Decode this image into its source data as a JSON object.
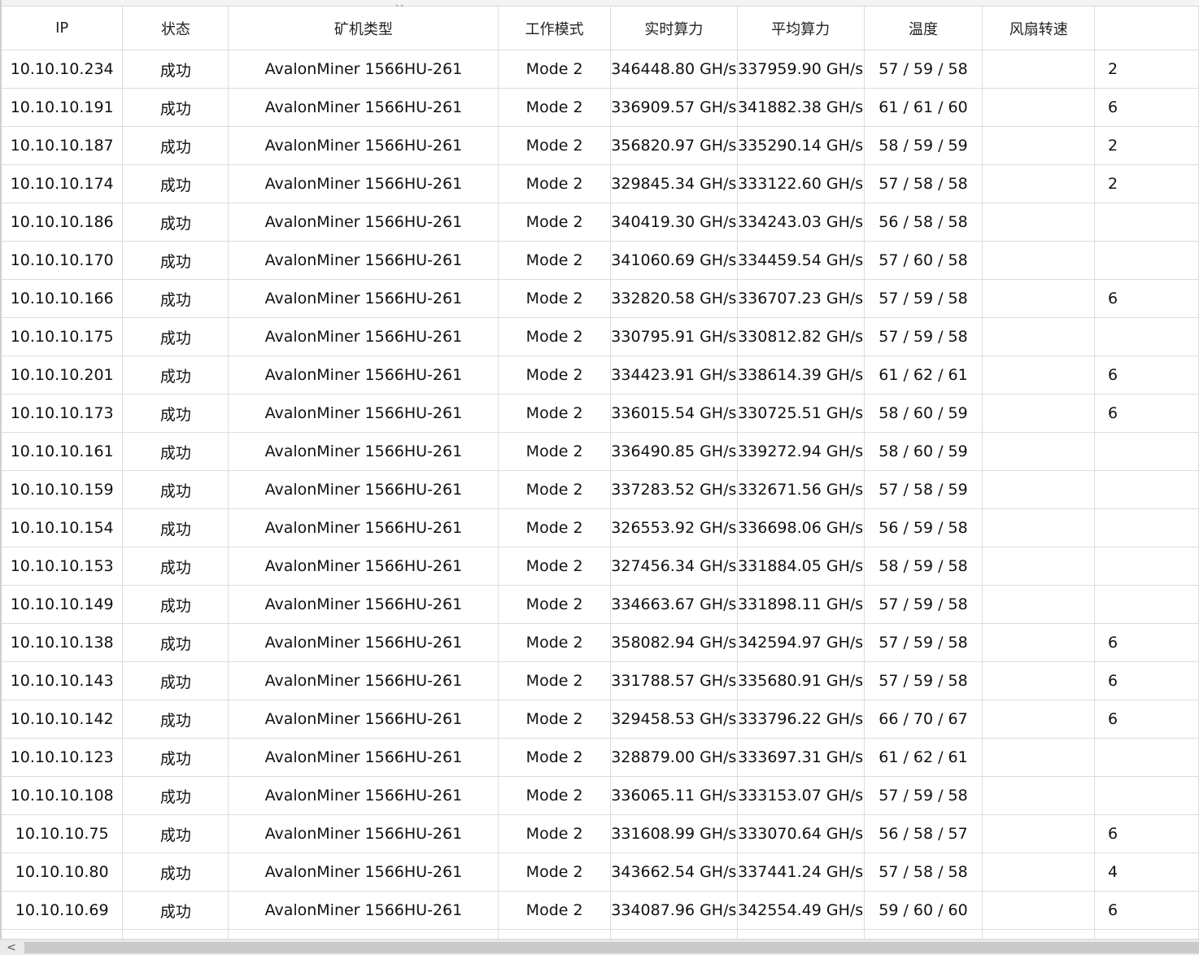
{
  "table": {
    "columns": [
      "IP",
      "状态",
      "矿机类型",
      "工作模式",
      "实时算力",
      "平均算力",
      "温度",
      "风扇转速",
      ""
    ],
    "rows": [
      [
        "10.10.10.234",
        "成功",
        "AvalonMiner 1566HU-261",
        "Mode 2",
        "346448.80 GH/s",
        "337959.90 GH/s",
        "57 / 59 / 58",
        "",
        "2"
      ],
      [
        "10.10.10.191",
        "成功",
        "AvalonMiner 1566HU-261",
        "Mode 2",
        "336909.57 GH/s",
        "341882.38 GH/s",
        "61 / 61 / 60",
        "",
        "6"
      ],
      [
        "10.10.10.187",
        "成功",
        "AvalonMiner 1566HU-261",
        "Mode 2",
        "356820.97 GH/s",
        "335290.14 GH/s",
        "58 / 59 / 59",
        "",
        "2"
      ],
      [
        "10.10.10.174",
        "成功",
        "AvalonMiner 1566HU-261",
        "Mode 2",
        "329845.34 GH/s",
        "333122.60 GH/s",
        "57 / 58 / 58",
        "",
        "2"
      ],
      [
        "10.10.10.186",
        "成功",
        "AvalonMiner 1566HU-261",
        "Mode 2",
        "340419.30 GH/s",
        "334243.03 GH/s",
        "56 / 58 / 58",
        "",
        ""
      ],
      [
        "10.10.10.170",
        "成功",
        "AvalonMiner 1566HU-261",
        "Mode 2",
        "341060.69 GH/s",
        "334459.54 GH/s",
        "57 / 60 / 58",
        "",
        ""
      ],
      [
        "10.10.10.166",
        "成功",
        "AvalonMiner 1566HU-261",
        "Mode 2",
        "332820.58 GH/s",
        "336707.23 GH/s",
        "57 / 59 / 58",
        "",
        "6"
      ],
      [
        "10.10.10.175",
        "成功",
        "AvalonMiner 1566HU-261",
        "Mode 2",
        "330795.91 GH/s",
        "330812.82 GH/s",
        "57 / 59 / 58",
        "",
        ""
      ],
      [
        "10.10.10.201",
        "成功",
        "AvalonMiner 1566HU-261",
        "Mode 2",
        "334423.91 GH/s",
        "338614.39 GH/s",
        "61 / 62 / 61",
        "",
        "6"
      ],
      [
        "10.10.10.173",
        "成功",
        "AvalonMiner 1566HU-261",
        "Mode 2",
        "336015.54 GH/s",
        "330725.51 GH/s",
        "58 / 60 / 59",
        "",
        "6"
      ],
      [
        "10.10.10.161",
        "成功",
        "AvalonMiner 1566HU-261",
        "Mode 2",
        "336490.85 GH/s",
        "339272.94 GH/s",
        "58 / 60 / 59",
        "",
        ""
      ],
      [
        "10.10.10.159",
        "成功",
        "AvalonMiner 1566HU-261",
        "Mode 2",
        "337283.52 GH/s",
        "332671.56 GH/s",
        "57 / 58 / 59",
        "",
        ""
      ],
      [
        "10.10.10.154",
        "成功",
        "AvalonMiner 1566HU-261",
        "Mode 2",
        "326553.92 GH/s",
        "336698.06 GH/s",
        "56 / 59 / 58",
        "",
        ""
      ],
      [
        "10.10.10.153",
        "成功",
        "AvalonMiner 1566HU-261",
        "Mode 2",
        "327456.34 GH/s",
        "331884.05 GH/s",
        "58 / 59 / 58",
        "",
        ""
      ],
      [
        "10.10.10.149",
        "成功",
        "AvalonMiner 1566HU-261",
        "Mode 2",
        "334663.67 GH/s",
        "331898.11 GH/s",
        "57 / 59 / 58",
        "",
        ""
      ],
      [
        "10.10.10.138",
        "成功",
        "AvalonMiner 1566HU-261",
        "Mode 2",
        "358082.94 GH/s",
        "342594.97 GH/s",
        "57 / 59 / 58",
        "",
        "6"
      ],
      [
        "10.10.10.143",
        "成功",
        "AvalonMiner 1566HU-261",
        "Mode 2",
        "331788.57 GH/s",
        "335680.91 GH/s",
        "57 / 59 / 58",
        "",
        "6"
      ],
      [
        "10.10.10.142",
        "成功",
        "AvalonMiner 1566HU-261",
        "Mode 2",
        "329458.53 GH/s",
        "333796.22 GH/s",
        "66 / 70 / 67",
        "",
        "6"
      ],
      [
        "10.10.10.123",
        "成功",
        "AvalonMiner 1566HU-261",
        "Mode 2",
        "328879.00 GH/s",
        "333697.31 GH/s",
        "61 / 62 / 61",
        "",
        ""
      ],
      [
        "10.10.10.108",
        "成功",
        "AvalonMiner 1566HU-261",
        "Mode 2",
        "336065.11 GH/s",
        "333153.07 GH/s",
        "57 / 59 / 58",
        "",
        ""
      ],
      [
        "10.10.10.75",
        "成功",
        "AvalonMiner 1566HU-261",
        "Mode 2",
        "331608.99 GH/s",
        "333070.64 GH/s",
        "56 / 58 / 57",
        "",
        "6"
      ],
      [
        "10.10.10.80",
        "成功",
        "AvalonMiner 1566HU-261",
        "Mode 2",
        "343662.54 GH/s",
        "337441.24 GH/s",
        "57 / 58 / 58",
        "",
        "4"
      ],
      [
        "10.10.10.69",
        "成功",
        "AvalonMiner 1566HU-261",
        "Mode 2",
        "334087.96 GH/s",
        "342554.49 GH/s",
        "59 / 60 / 60",
        "",
        "6"
      ]
    ]
  },
  "scrollbar": {
    "left_arrow": "<"
  },
  "icons": {
    "sort": "sort-chevron-down-icon"
  },
  "colors": {
    "grid_line": "#dcdcdc",
    "scrollbar_track": "#eaeaea",
    "scrollbar_thumb": "#c9c9c9"
  }
}
